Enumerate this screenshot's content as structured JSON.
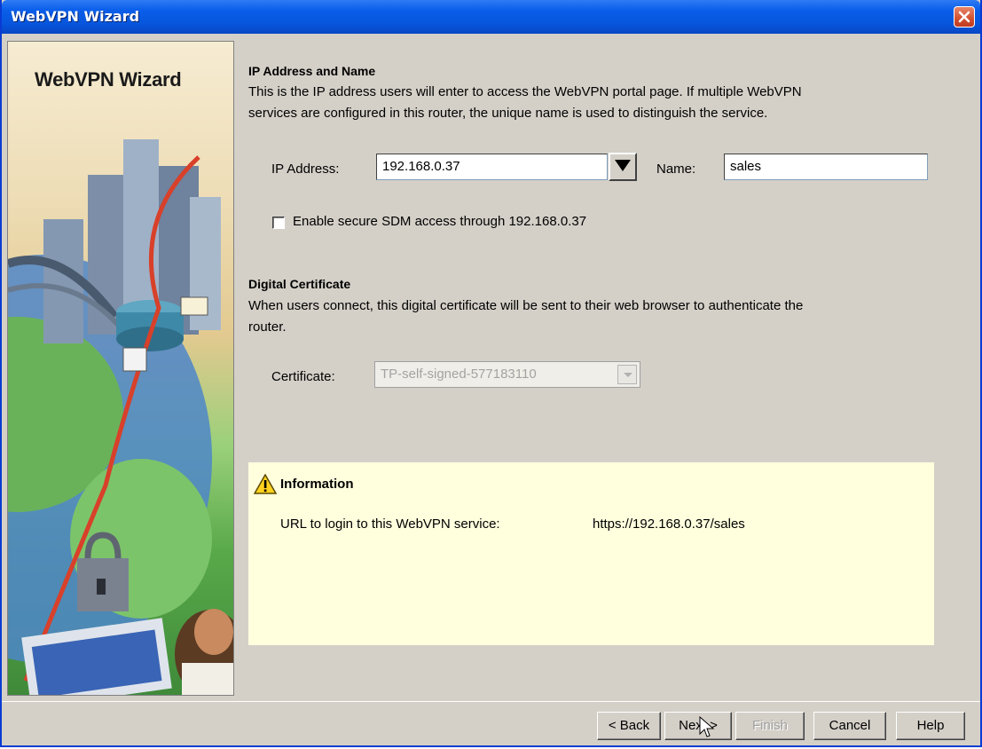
{
  "window": {
    "title": "WebVPN Wizard"
  },
  "side_panel": {
    "title": "WebVPN Wizard"
  },
  "ip_section": {
    "heading": "IP Address and Name",
    "description_line1": "This is the IP address users will enter to access the WebVPN portal page. If multiple WebVPN",
    "description_line2": "services are configured in this router, the unique name is used to distinguish the service.",
    "ip_label": "IP Address:",
    "ip_value": "192.168.0.37",
    "name_label": "Name:",
    "name_value": "sales",
    "checkbox_label": "Enable secure SDM access through 192.168.0.37",
    "checkbox_checked": false
  },
  "cert_section": {
    "heading": "Digital Certificate",
    "description_line1": "When users connect, this digital certificate will be sent to their web browser to authenticate the",
    "description_line2": "router.",
    "cert_label": "Certificate:",
    "cert_value": "TP-self-signed-577183110"
  },
  "info": {
    "title": "Information",
    "url_label": "URL to login to this WebVPN service:",
    "url_value": "https://192.168.0.37/sales"
  },
  "buttons": {
    "back": "< Back",
    "next": "Next >",
    "finish": "Finish",
    "cancel": "Cancel",
    "help": "Help"
  },
  "colors": {
    "titlebar": "#0a5ee9",
    "info_background": "#ffffde",
    "dialog_background": "#d4d0c8"
  }
}
